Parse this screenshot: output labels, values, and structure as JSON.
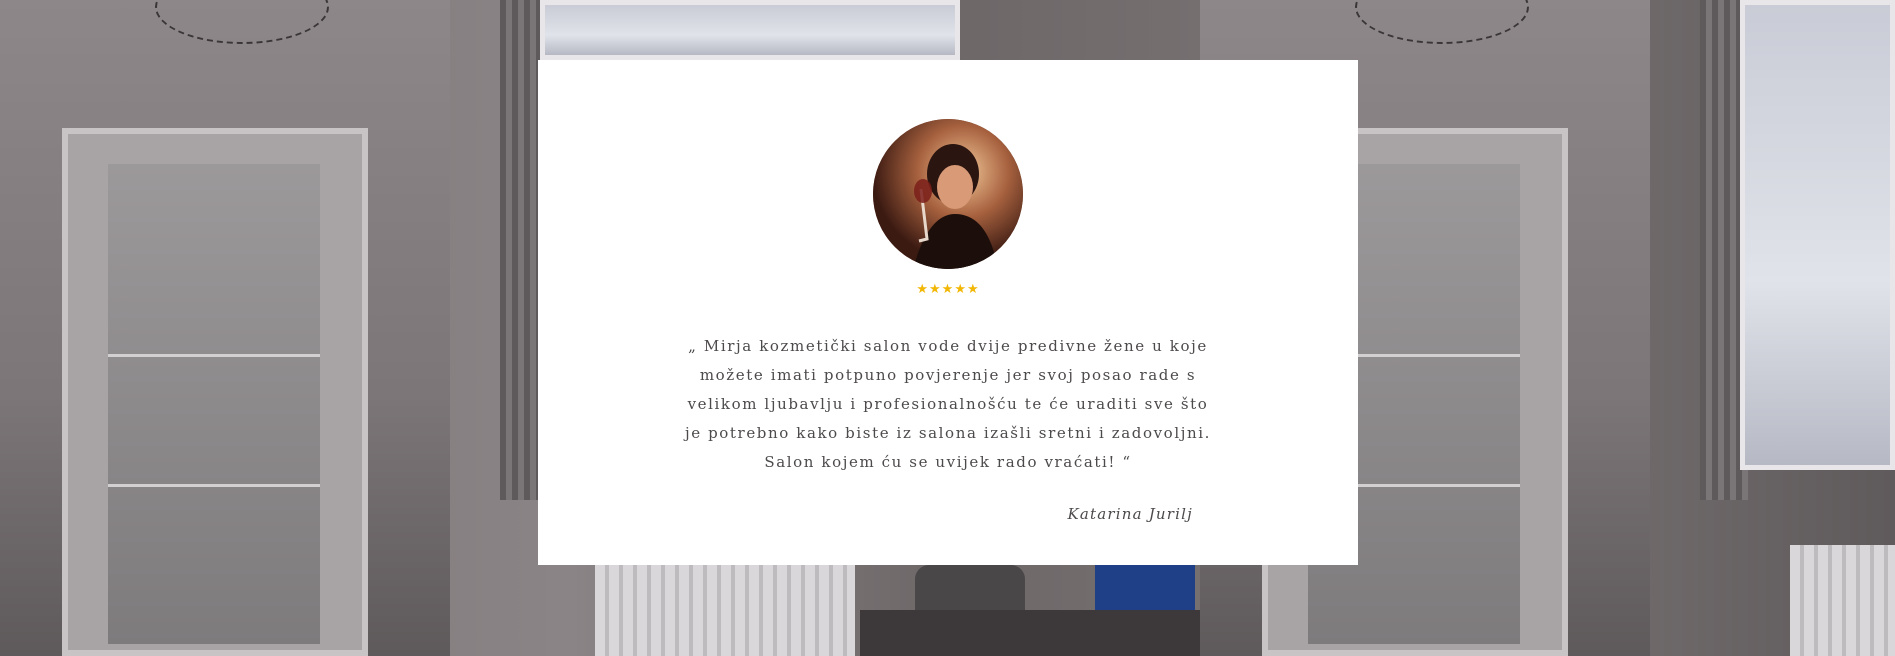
{
  "testimonial": {
    "rating": 5,
    "rating_stars": "★★★★★",
    "quote": "„ Mirja kozmetički salon vode dvije predivne žene u koje možete imati potpuno povjerenje jer svoj posao rade s velikom ljubavlju i profesionalnošću te će uraditi sve što je potrebno kako biste iz salona izašli sretni i zadovoljni. Salon kojem ću se uvijek rado vraćati! “",
    "author": "Katarina Jurilj"
  },
  "colors": {
    "card_background": "#ffffff",
    "star_color": "#f2b705",
    "text_color": "#4d4a4b"
  }
}
